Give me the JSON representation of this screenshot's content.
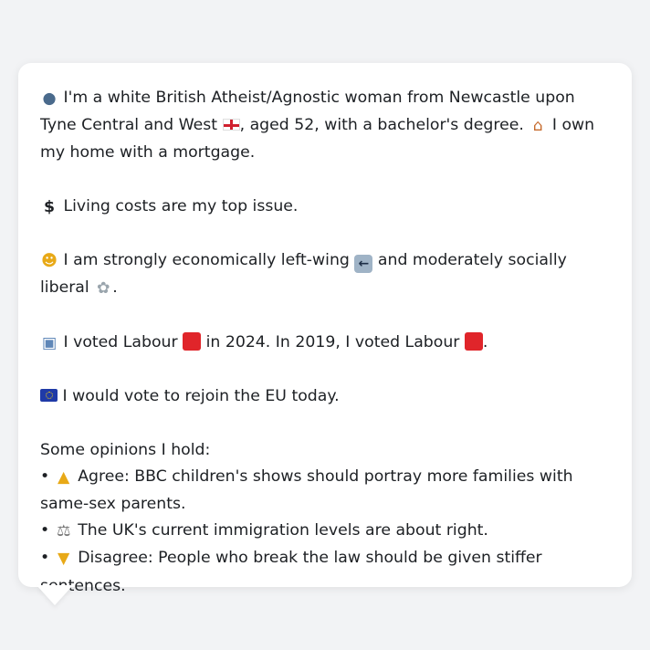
{
  "message": {
    "line1": {
      "icon": "bust-silhouette-icon",
      "text_a": "I'm a white British Atheist/Agnostic woman from Newcastle upon Tyne Central and West",
      "flag": "england-flag-icon",
      "text_b": ", aged 52, with a bachelor's degree.",
      "house_icon": "house-icon",
      "text_c": "I own my home with a mortgage."
    },
    "issue": {
      "icon": "dollar-sign-icon",
      "text": "Living costs are my top issue."
    },
    "ideology": {
      "icon": "thinking-face-icon",
      "text_a": "I am strongly economically left-wing",
      "left_icon": "left-arrow-icon",
      "text_b": "and moderately socially liberal",
      "dove_icon": "dove-icon",
      "text_c": "."
    },
    "votes": {
      "icon": "ballot-box-icon",
      "text_a": "I voted Labour",
      "text_b": "in 2024. In 2019, I voted Labour",
      "text_c": ".",
      "party_color": "#e0252a"
    },
    "eu": {
      "icon": "eu-flag-icon",
      "text": "I would vote to rejoin the EU today."
    },
    "opinions": {
      "heading": "Some opinions I hold:",
      "items": [
        {
          "bullet": "•",
          "icon": "thumbs-up-icon",
          "text": "Agree: BBC children's shows should portray more families with same-sex parents."
        },
        {
          "bullet": "•",
          "icon": "balance-scale-icon",
          "text": "The UK's current immigration levels are about right."
        },
        {
          "bullet": "•",
          "icon": "thumbs-down-icon",
          "text": "Disagree: People who break the law should be given stiffer sentences."
        }
      ]
    }
  }
}
